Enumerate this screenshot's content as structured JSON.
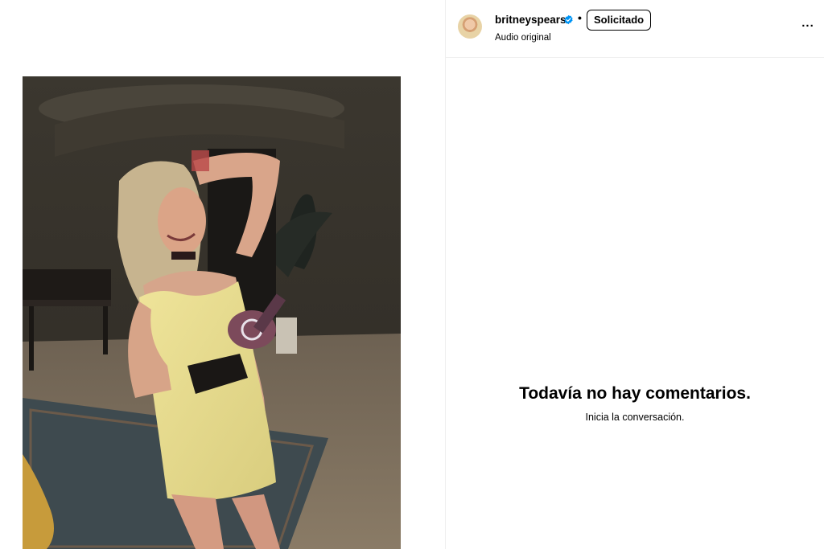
{
  "post": {
    "author": {
      "username": "britneyspears",
      "verified": true,
      "verified_icon": "verified-badge-icon",
      "separator": "•",
      "follow_button_label": "Solicitado",
      "audio_label": "Audio original"
    },
    "more_options_label": "...",
    "media": {
      "type": "video",
      "description_icon": "video-frame"
    }
  },
  "comments": {
    "empty_title": "Todavía no hay comentarios.",
    "empty_subtitle": "Inicia la conversación."
  },
  "colors": {
    "background": "#ffffff",
    "divider": "#efefef",
    "verified_blue": "#0095f6",
    "text": "#000000"
  }
}
